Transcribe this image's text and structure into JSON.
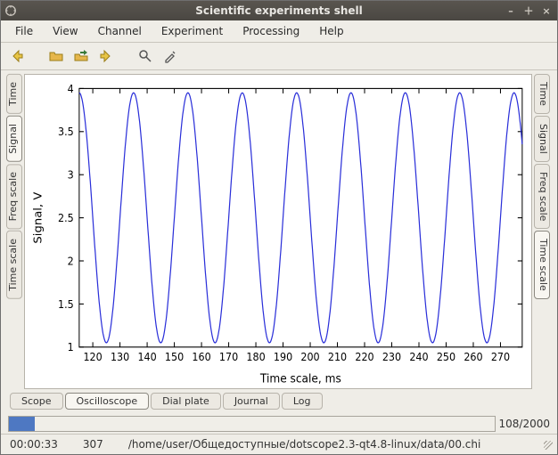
{
  "window": {
    "title": "Scientific experiments shell"
  },
  "menu": {
    "items": [
      "File",
      "View",
      "Channel",
      "Experiment",
      "Processing",
      "Help"
    ]
  },
  "vtabs_left": [
    {
      "label": "Time",
      "active": false
    },
    {
      "label": "Signal",
      "active": true
    },
    {
      "label": "Freq scale",
      "active": false
    },
    {
      "label": "Time scale",
      "active": false
    }
  ],
  "vtabs_right": [
    {
      "label": "Time",
      "active": false
    },
    {
      "label": "Signal",
      "active": false
    },
    {
      "label": "Freq scale",
      "active": false
    },
    {
      "label": "Time scale",
      "active": true
    }
  ],
  "bottom_tabs": [
    {
      "label": "Scope",
      "active": false
    },
    {
      "label": "Oscilloscope",
      "active": true
    },
    {
      "label": "Dial plate",
      "active": false
    },
    {
      "label": "Journal",
      "active": false
    },
    {
      "label": "Log",
      "active": false
    }
  ],
  "progress": {
    "value": 108,
    "max": 2000,
    "label": "108/2000"
  },
  "status": {
    "time": "00:00:33",
    "count": "307",
    "path": "/home/user/Общедоступные/dotscope2.3-qt4.8-linux/data/00.chi"
  },
  "chart_data": {
    "type": "line",
    "title": "",
    "xlabel": "Time scale, ms",
    "ylabel": "Signal, V",
    "xlim": [
      115,
      278
    ],
    "ylim": [
      1,
      4
    ],
    "xticks": [
      120,
      130,
      140,
      150,
      160,
      170,
      180,
      190,
      200,
      210,
      220,
      230,
      240,
      250,
      260,
      270
    ],
    "yticks": [
      1,
      1.5,
      2,
      2.5,
      3,
      3.5,
      4
    ],
    "series": [
      {
        "name": "signal",
        "color": "#2a2fd9",
        "period_ms": 20,
        "amplitude_V": 1.45,
        "offset_V": 2.5,
        "phase_at_x0_deg": 90,
        "cycles_visible": 8
      }
    ]
  }
}
